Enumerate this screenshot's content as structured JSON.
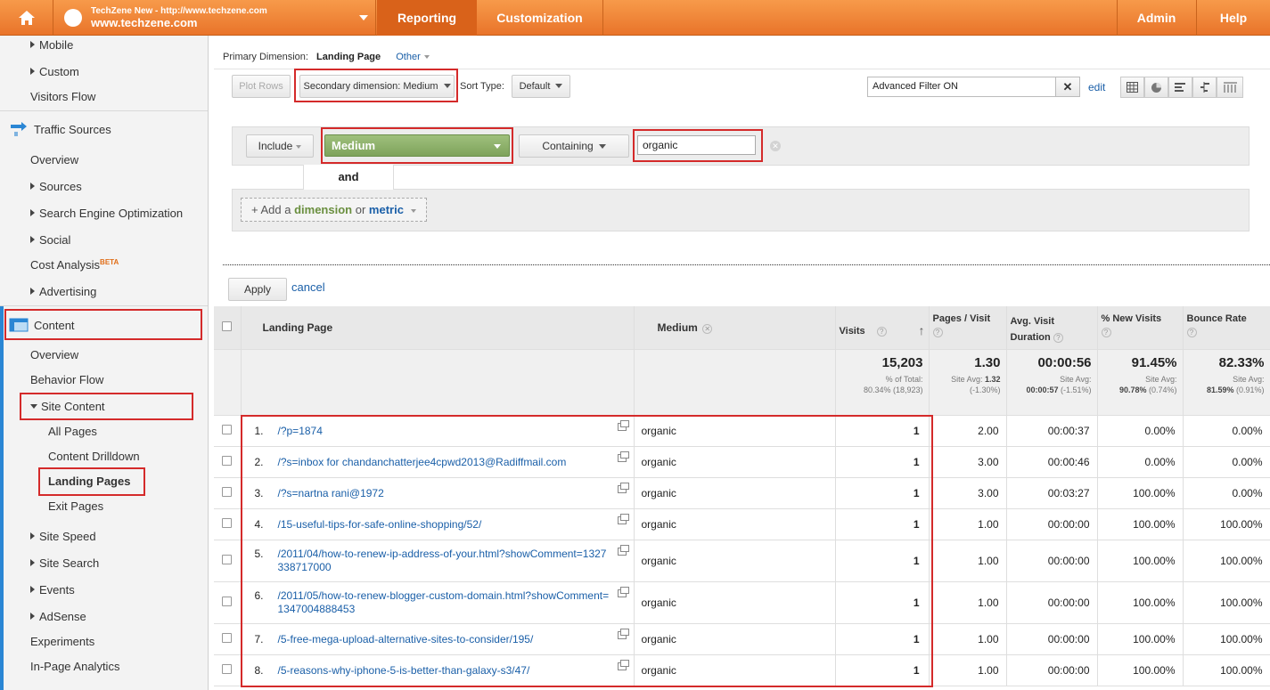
{
  "topbar": {
    "account_line1": "TechZene New - http://www.techzene.com",
    "account_line2": "www.techzene.com",
    "nav_reporting": "Reporting",
    "nav_customization": "Customization",
    "nav_admin": "Admin",
    "nav_help": "Help",
    "brand_color": "#ef8133"
  },
  "sidebar": {
    "mobile": "Mobile",
    "custom": "Custom",
    "visitors_flow": "Visitors Flow",
    "traffic_sources": "Traffic Sources",
    "ts_overview": "Overview",
    "sources": "Sources",
    "seo": "Search Engine Optimization",
    "social": "Social",
    "cost_analysis": "Cost Analysis",
    "beta": "BETA",
    "advertising": "Advertising",
    "content": "Content",
    "c_overview": "Overview",
    "behavior_flow": "Behavior Flow",
    "site_content": "Site Content",
    "all_pages": "All Pages",
    "content_drilldown": "Content Drilldown",
    "landing_pages": "Landing Pages",
    "exit_pages": "Exit Pages",
    "site_speed": "Site Speed",
    "site_search": "Site Search",
    "events": "Events",
    "adsense": "AdSense",
    "experiments": "Experiments",
    "in_page_analytics": "In-Page Analytics"
  },
  "toolbar": {
    "primary_dimension_label": "Primary Dimension:",
    "primary_dimension_value": "Landing Page",
    "other": "Other",
    "plot_rows": "Plot Rows",
    "secondary_dimension": "Secondary dimension: Medium",
    "sort_type_label": "Sort Type:",
    "sort_type_value": "Default",
    "advanced_filter": "Advanced Filter ON",
    "clear": "✕",
    "edit": "edit"
  },
  "filter": {
    "include": "Include",
    "dimension": "Medium",
    "match": "Containing",
    "value": "organic",
    "and": "and",
    "add_prefix": "+ Add a",
    "add_dimension": "dimension",
    "add_or": "or",
    "add_metric": "metric",
    "apply": "Apply",
    "cancel": "cancel"
  },
  "table": {
    "headers": {
      "landing_page": "Landing Page",
      "medium": "Medium",
      "visits": "Visits",
      "pages_visit": "Pages / Visit",
      "avg_visit": "Avg. Visit Duration",
      "new_visits": "% New Visits",
      "bounce": "Bounce Rate"
    },
    "totals": {
      "visits": "15,203",
      "visits_pct_label": "% of Total:",
      "visits_pct": "80.34% (18,923)",
      "pages_visit": "1.30",
      "pages_avg_label": "Site Avg:",
      "pages_avg_val": "1.32",
      "pages_avg_diff": "(-1.30%)",
      "avg_visit": "00:00:56",
      "avg_visit_avg_label": "Site Avg:",
      "avg_visit_avg_val": "00:00:57",
      "avg_visit_avg_diff": "(-1.51%)",
      "new_visits": "91.45%",
      "new_avg_label": "Site Avg:",
      "new_avg_val": "90.78%",
      "new_avg_diff": "(0.74%)",
      "bounce": "82.33%",
      "bounce_avg_label": "Site Avg:",
      "bounce_avg_val": "81.59%",
      "bounce_avg_diff": "(0.91%)"
    },
    "rows": [
      {
        "n": "1.",
        "page": "/?p=1874",
        "medium": "organic",
        "visits": "1",
        "pages": "2.00",
        "avg": "00:00:37",
        "new": "0.00%",
        "bounce": "0.00%"
      },
      {
        "n": "2.",
        "page": "/?s=inbox for chandanchatterjee4cpwd2013@Radiffmail.com",
        "medium": "organic",
        "visits": "1",
        "pages": "3.00",
        "avg": "00:00:46",
        "new": "0.00%",
        "bounce": "0.00%"
      },
      {
        "n": "3.",
        "page": "/?s=nartna rani@1972",
        "medium": "organic",
        "visits": "1",
        "pages": "3.00",
        "avg": "00:03:27",
        "new": "100.00%",
        "bounce": "0.00%"
      },
      {
        "n": "4.",
        "page": "/15-useful-tips-for-safe-online-shopping/52/",
        "medium": "organic",
        "visits": "1",
        "pages": "1.00",
        "avg": "00:00:00",
        "new": "100.00%",
        "bounce": "100.00%"
      },
      {
        "n": "5.",
        "page": "/2011/04/how-to-renew-ip-address-of-your.html?showComment=1327338717000",
        "medium": "organic",
        "visits": "1",
        "pages": "1.00",
        "avg": "00:00:00",
        "new": "100.00%",
        "bounce": "100.00%"
      },
      {
        "n": "6.",
        "page": "/2011/05/how-to-renew-blogger-custom-domain.html?showComment=1347004888453",
        "medium": "organic",
        "visits": "1",
        "pages": "1.00",
        "avg": "00:00:00",
        "new": "100.00%",
        "bounce": "100.00%"
      },
      {
        "n": "7.",
        "page": "/5-free-mega-upload-alternative-sites-to-consider/195/",
        "medium": "organic",
        "visits": "1",
        "pages": "1.00",
        "avg": "00:00:00",
        "new": "100.00%",
        "bounce": "100.00%"
      },
      {
        "n": "8.",
        "page": "/5-reasons-why-iphone-5-is-better-than-galaxy-s3/47/",
        "medium": "organic",
        "visits": "1",
        "pages": "1.00",
        "avg": "00:00:00",
        "new": "100.00%",
        "bounce": "100.00%"
      }
    ]
  }
}
